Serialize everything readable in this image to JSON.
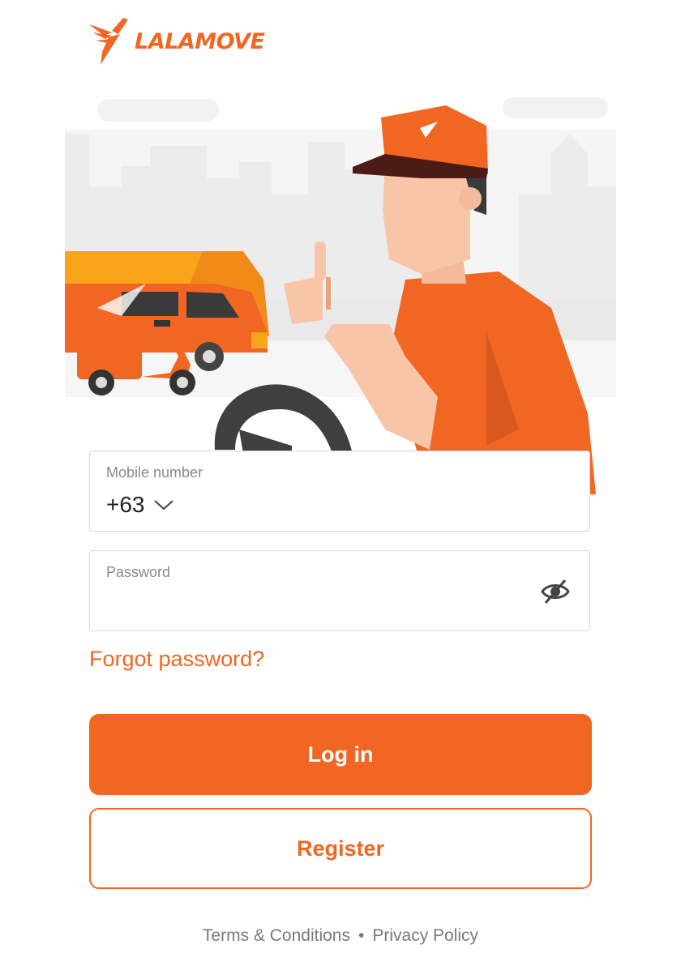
{
  "brand": {
    "name": "LALAMOVE",
    "color": "#f16622"
  },
  "form": {
    "mobile": {
      "label": "Mobile number",
      "country_code": "+63",
      "dropdown_icon": "chevron-down-icon"
    },
    "password": {
      "label": "Password",
      "value": "",
      "toggle_icon": "eye-off-icon"
    },
    "forgot_label": "Forgot password?"
  },
  "actions": {
    "login_label": "Log in",
    "register_label": "Register"
  },
  "footer": {
    "terms": "Terms & Conditions",
    "separator": "•",
    "privacy": "Privacy Policy"
  }
}
